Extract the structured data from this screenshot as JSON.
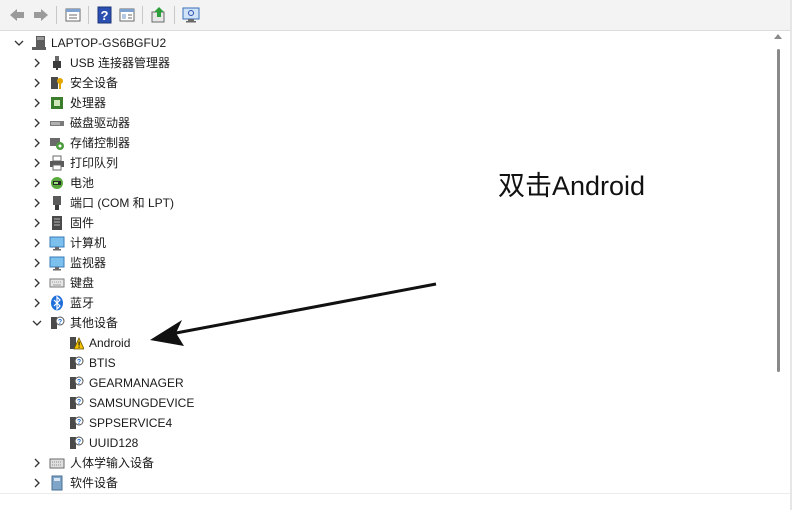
{
  "toolbar": {
    "buttons": [
      {
        "name": "back-icon",
        "glyph": "⇦"
      },
      {
        "name": "forward-icon",
        "glyph": "⇨"
      },
      {
        "name": "properties-icon",
        "glyph": "▤"
      },
      {
        "name": "help-icon",
        "glyph": "?"
      },
      {
        "name": "view-icon",
        "glyph": "▥"
      },
      {
        "name": "update-driver-icon",
        "glyph": "⇧"
      },
      {
        "name": "scan-hardware-icon",
        "glyph": "⌨"
      }
    ]
  },
  "tree": {
    "root": {
      "label": "LAPTOP-GS6BGFU2",
      "icon": "computer-icon"
    },
    "categories": [
      {
        "label": "USB 连接器管理器",
        "icon": "usb-icon",
        "expanded": false
      },
      {
        "label": "安全设备",
        "icon": "security-key-icon",
        "expanded": false
      },
      {
        "label": "处理器",
        "icon": "processor-icon",
        "expanded": false
      },
      {
        "label": "磁盘驱动器",
        "icon": "disk-drive-icon",
        "expanded": false
      },
      {
        "label": "存储控制器",
        "icon": "storage-controller-icon",
        "expanded": false
      },
      {
        "label": "打印队列",
        "icon": "printer-icon",
        "expanded": false
      },
      {
        "label": "电池",
        "icon": "battery-icon",
        "expanded": false
      },
      {
        "label": "端口 (COM 和 LPT)",
        "icon": "port-icon",
        "expanded": false
      },
      {
        "label": "固件",
        "icon": "firmware-icon",
        "expanded": false
      },
      {
        "label": "计算机",
        "icon": "computer-monitor-icon",
        "expanded": false
      },
      {
        "label": "监视器",
        "icon": "monitor-icon",
        "expanded": false
      },
      {
        "label": "键盘",
        "icon": "keyboard-icon",
        "expanded": false
      },
      {
        "label": "蓝牙",
        "icon": "bluetooth-icon",
        "expanded": false
      },
      {
        "label": "其他设备",
        "icon": "unknown-device-icon",
        "expanded": true
      },
      {
        "label": "人体学输入设备",
        "icon": "hid-icon",
        "expanded": false
      },
      {
        "label": "软件设备",
        "icon": "software-device-icon",
        "expanded": false
      }
    ],
    "other_devices": [
      {
        "label": "Android",
        "icon": "warning-device-icon"
      },
      {
        "label": "BTIS",
        "icon": "unknown-device-icon"
      },
      {
        "label": "GEARMANAGER",
        "icon": "unknown-device-icon"
      },
      {
        "label": "SAMSUNGDEVICE",
        "icon": "unknown-device-icon"
      },
      {
        "label": "SPPSERVICE4",
        "icon": "unknown-device-icon"
      },
      {
        "label": "UUID128",
        "icon": "unknown-device-icon"
      }
    ]
  },
  "annotation": {
    "text": "双击Android"
  },
  "colors": {
    "toolbar_bg": "#f3f3f3",
    "blue_icon": "#1e6fd9",
    "warning_yellow": "#f2c200"
  }
}
